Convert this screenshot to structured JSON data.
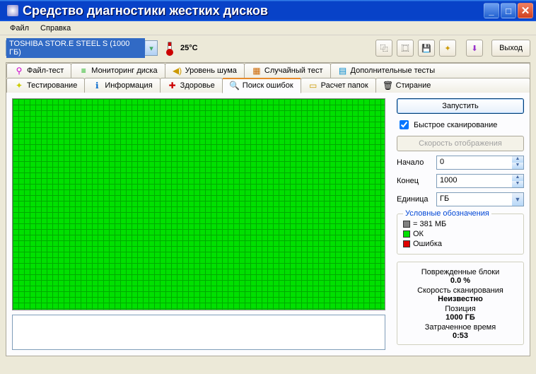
{
  "title": "Средство диагностики жестких дисков",
  "menu": {
    "file": "Файл",
    "help": "Справка"
  },
  "drive": "TOSHIBA STOR.E STEEL S   (1000 ГБ)",
  "temp": "25°C",
  "exit": "Выход",
  "tabs_top": [
    "Файл-тест",
    "Мониторинг диска",
    "Уровень шума",
    "Случайный тест",
    "Дополнительные тесты"
  ],
  "tabs_bot": [
    "Тестирование",
    "Информация",
    "Здоровье",
    "Поиск ошибок",
    "Расчет папок",
    "Стирание"
  ],
  "right": {
    "run": "Запустить",
    "quick": "Быстрое сканирование",
    "disp_rate": "Скорость отображения",
    "start_lbl": "Начало",
    "start_val": "0",
    "end_lbl": "Конец",
    "end_val": "1000",
    "unit_lbl": "Единица",
    "unit_val": "ГБ",
    "legend_title": "Условные обозначения",
    "legend_block": "= 381 МБ",
    "legend_ok": "ОК",
    "legend_err": "Ошибка",
    "stats": {
      "damaged_lbl": "Поврежденные блоки",
      "damaged_val": "0.0 %",
      "speed_lbl": "Скорость сканирования",
      "speed_val": "Неизвестно",
      "pos_lbl": "Позиция",
      "pos_val": "1000 ГБ",
      "time_lbl": "Затраченное время",
      "time_val": "0:53"
    }
  },
  "colors": {
    "ok": "#00e000",
    "err": "#e00000",
    "block": "#808080"
  }
}
